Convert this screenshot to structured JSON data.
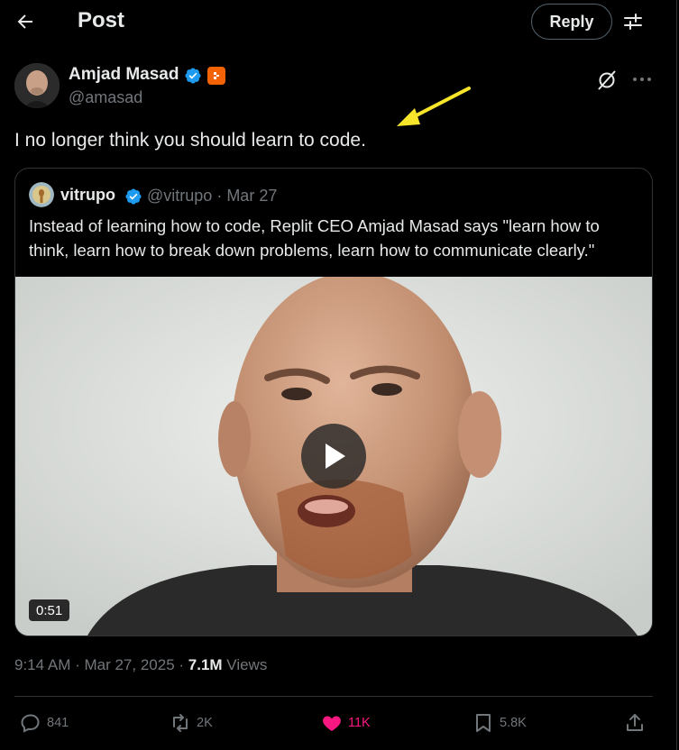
{
  "header": {
    "title": "Post",
    "reply_label": "Reply",
    "icons": [
      "back-arrow-icon",
      "filter-icon"
    ]
  },
  "post": {
    "author": {
      "name": "Amjad Masad",
      "handle": "@amasad",
      "verified": true,
      "affiliation_badge": "replit"
    },
    "text": "I no longer think you should learn to code.",
    "timestamp": "9:14 AM · Mar 27, 2025 · ",
    "views_count": "7.1M",
    "views_label": " Views"
  },
  "quote": {
    "author_name": "vitrupo",
    "author_handle": "@vitrupo",
    "date_sep": " · ",
    "date": "Mar 27",
    "text": "Instead of learning how to code, Replit CEO Amjad Masad says \"learn how to think, learn how to break down problems, learn how to communicate clearly.\"",
    "video_duration": "0:51"
  },
  "actions": {
    "replies": "841",
    "reposts": "2K",
    "likes": "11K",
    "bookmarks": "5.8K"
  },
  "colors": {
    "background": "#000000",
    "text_primary": "#e7e9ea",
    "text_secondary": "#71767b",
    "verified_blue": "#1d9bf0",
    "like_pink": "#f91880",
    "replit_orange": "#f26207",
    "annotation_arrow": "#f7e52b",
    "border": "#2f3336"
  }
}
